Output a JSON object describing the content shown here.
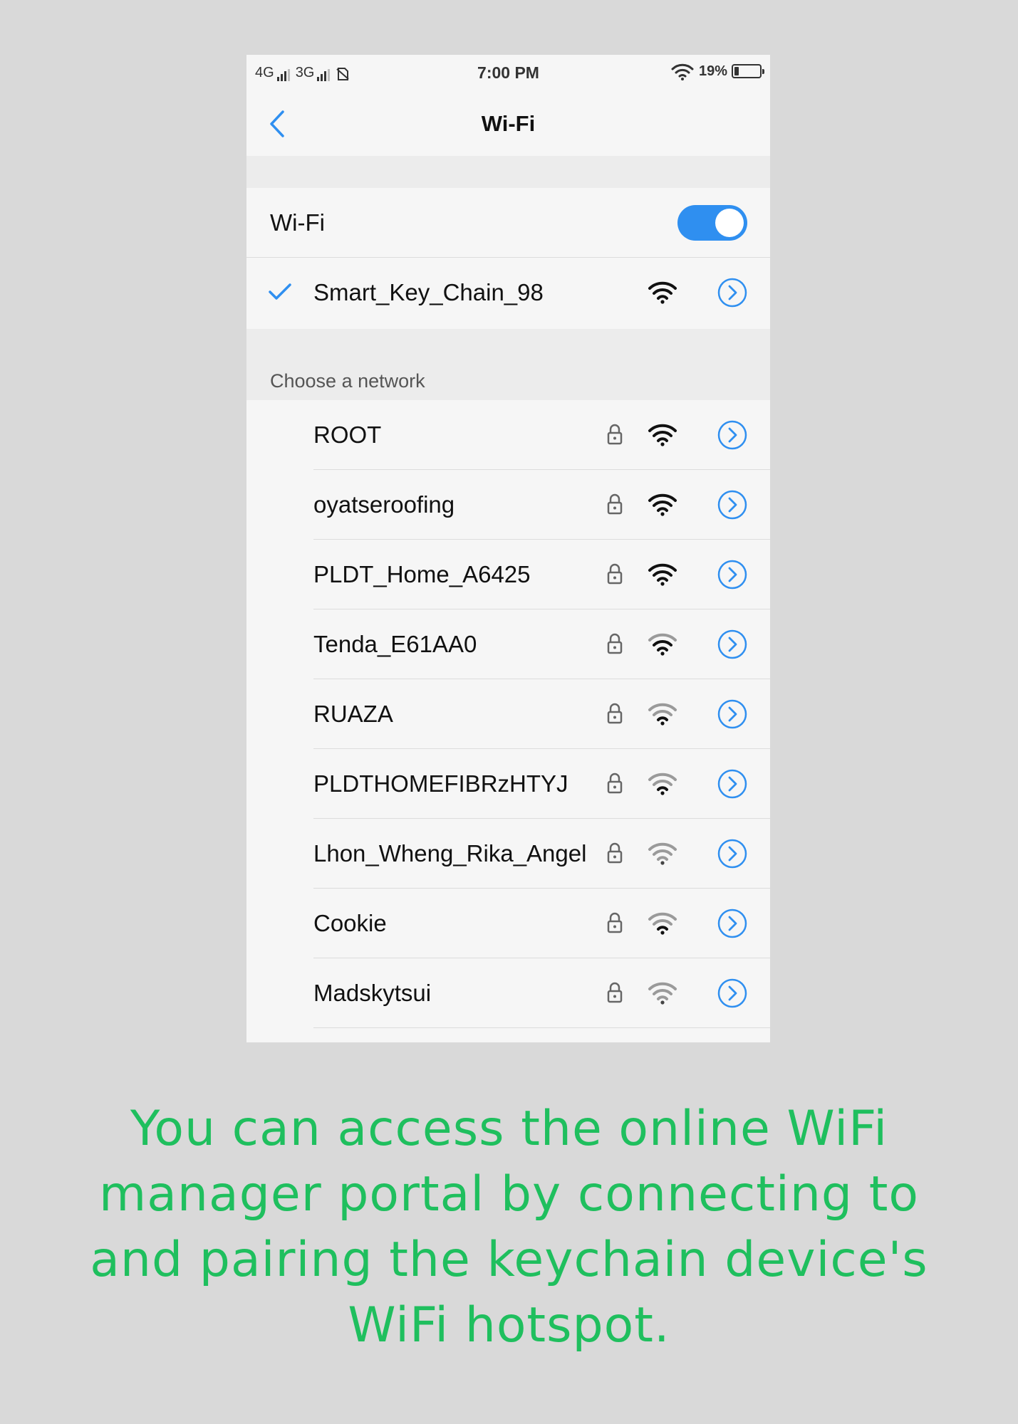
{
  "status_bar": {
    "network_1": "4G",
    "network_2": "3G",
    "time": "7:00 PM",
    "battery": "19%",
    "battery_level": 0.19
  },
  "nav": {
    "title": "Wi-Fi",
    "back_icon": "chevron-left-icon"
  },
  "wifi_toggle": {
    "label": "Wi-Fi",
    "state": "on"
  },
  "connected": {
    "name": "Smart_Key_Chain_98",
    "signal_level": 4,
    "icons": [
      "check-icon",
      "wifi-icon",
      "chevron-circle-icon"
    ]
  },
  "section_label": "Choose a network",
  "networks": [
    {
      "name": "ROOT",
      "locked": true,
      "signal_level": 4
    },
    {
      "name": "oyatseroofing",
      "locked": true,
      "signal_level": 4
    },
    {
      "name": "PLDT_Home_A6425",
      "locked": true,
      "signal_level": 4
    },
    {
      "name": "Tenda_E61AA0",
      "locked": true,
      "signal_level": 3
    },
    {
      "name": "RUAZA",
      "locked": true,
      "signal_level": 2
    },
    {
      "name": "PLDTHOMEFIBRzHTYJ",
      "locked": true,
      "signal_level": 2
    },
    {
      "name": "Lhon_Wheng_Rika_Angel",
      "locked": true,
      "signal_level": 1
    },
    {
      "name": "Cookie",
      "locked": true,
      "signal_level": 2
    },
    {
      "name": "Madskytsui",
      "locked": true,
      "signal_level": 1
    }
  ],
  "caption": "You can access the online WiFi manager portal by connecting to and pairing the keychain device's WiFi hotspot.",
  "colors": {
    "accent": "#2f8ff0",
    "caption": "#1fbf5e",
    "background": "#d9d9d9",
    "screen": "#f6f6f6"
  }
}
